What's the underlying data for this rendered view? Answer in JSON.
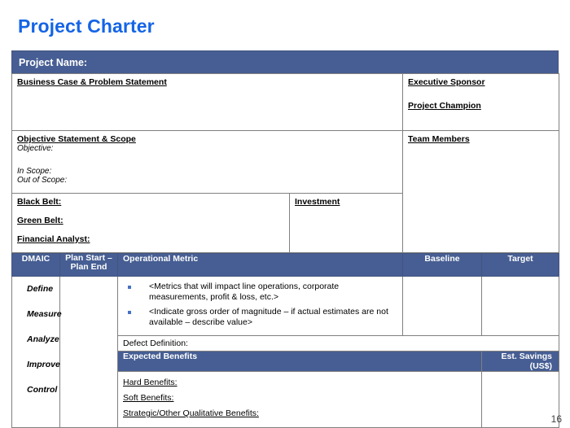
{
  "slide": {
    "title": "Project Charter",
    "page_number": "16"
  },
  "colors": {
    "title_blue": "#1464E6",
    "band_navy": "#465E93",
    "bullet_blue": "#4472C4",
    "grid_gray": "#808080"
  },
  "charter": {
    "project_name_label": "Project Name:",
    "business_case_label": "Business Case & Problem Statement",
    "executive_sponsor_label": "Executive Sponsor",
    "project_champion_label": "Project Champion",
    "objective_scope_label": "Objective Statement & Scope",
    "objective_label": "Objective:",
    "in_scope_label": "In Scope:",
    "out_of_scope_label": "Out of Scope:",
    "team_members_label": "Team Members",
    "black_belt_label": "Black Belt:",
    "green_belt_label": "Green Belt:",
    "financial_analyst_label": "Financial Analyst:",
    "investment_label": "Investment"
  },
  "metrics_table": {
    "headers": {
      "dmaic": "DMAIC",
      "plan_dates_line1": "Plan Start –",
      "plan_dates_line2": "Plan End",
      "operational_metric": "Operational Metric",
      "baseline": "Baseline",
      "target": "Target"
    },
    "phases": [
      {
        "label": "Define"
      },
      {
        "label": "Measure"
      },
      {
        "label": "Analyze"
      },
      {
        "label": "Improve"
      },
      {
        "label": "Control"
      }
    ],
    "metric_bullets": [
      "<Metrics that will impact line operations, corporate measurements, profit & loss, etc.>",
      "<Indicate gross order of magnitude – if actual estimates are not available – describe value>"
    ],
    "defect_definition_label": "Defect Definition:",
    "expected_benefits_label": "Expected Benefits",
    "est_savings_label": "Est. Savings (US$)",
    "benefits": [
      {
        "label": "Hard Benefits:"
      },
      {
        "label": "Soft Benefits:"
      },
      {
        "label": "Strategic/Other Qualitative Benefits:"
      }
    ]
  }
}
